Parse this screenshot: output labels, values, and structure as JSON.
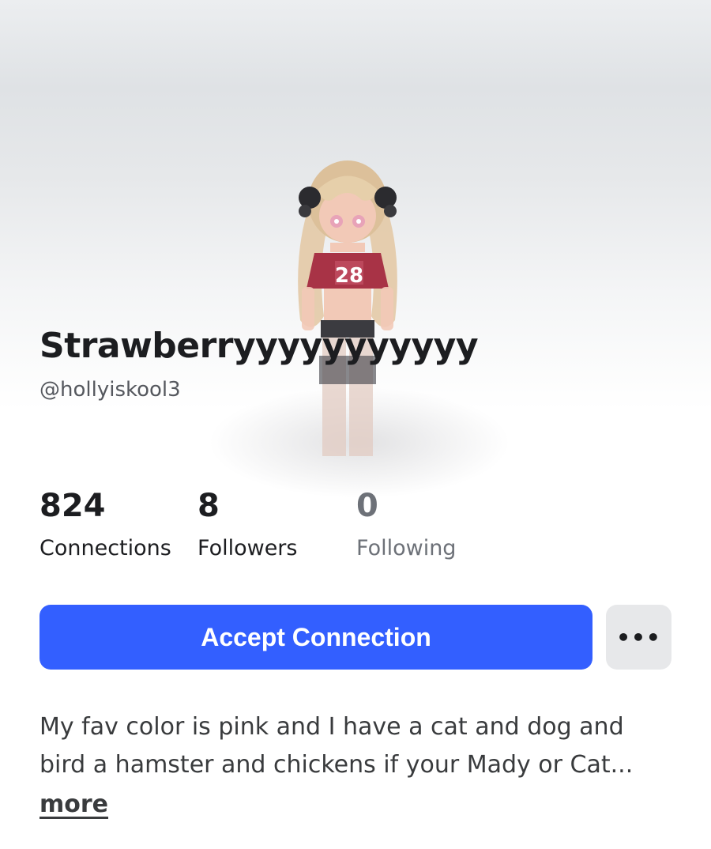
{
  "profile": {
    "display_name": "Strawberryyyyyyyyyyy",
    "username": "@hollyiskool3"
  },
  "stats": [
    {
      "value": "824",
      "label": "Connections"
    },
    {
      "value": "8",
      "label": "Followers"
    },
    {
      "value": "0",
      "label": "Following"
    }
  ],
  "actions": {
    "primary_label": "Accept Connection",
    "more_label": "•••"
  },
  "bio": {
    "text": "My fav color is pink and I have a cat and dog and bird a hamster and chickens if your Mady or Cat...",
    "more_label": "more"
  },
  "avatar": {
    "jersey_number": "28"
  },
  "colors": {
    "accent": "#335fff",
    "secondary_button": "#e7e8ea",
    "text": "#1c1d20",
    "muted": "#6d7178"
  }
}
